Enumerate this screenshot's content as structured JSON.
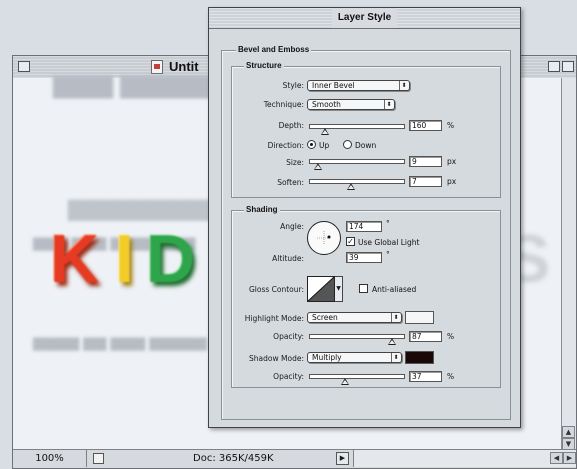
{
  "document": {
    "title": "Untit",
    "zoom": "100%",
    "doc_info": "Doc: 365K/459K",
    "kids_letters": [
      "K",
      "I",
      "D",
      "S"
    ]
  },
  "dialog": {
    "title": "Layer Style",
    "section_title": "Bevel and Emboss",
    "structure": {
      "group_label": "Structure",
      "style_label": "Style:",
      "style_value": "Inner Bevel",
      "technique_label": "Technique:",
      "technique_value": "Smooth",
      "depth_label": "Depth:",
      "depth_value": "160",
      "depth_unit": "%",
      "depth_level": 0.16,
      "direction_label": "Direction:",
      "direction_up": "Up",
      "direction_down": "Down",
      "direction_selected": "Up",
      "size_label": "Size:",
      "size_value": "9",
      "size_unit": "px",
      "size_level": 0.09,
      "soften_label": "Soften:",
      "soften_value": "7",
      "soften_unit": "px",
      "soften_level": 0.44
    },
    "shading": {
      "group_label": "Shading",
      "angle_label": "Angle:",
      "angle_value": "174",
      "angle_unit": "°",
      "use_global_light": "Use Global Light",
      "use_global_light_checked": true,
      "altitude_label": "Altitude:",
      "altitude_value": "39",
      "altitude_unit": "°",
      "gloss_contour_label": "Gloss Contour:",
      "anti_aliased": "Anti-aliased",
      "anti_aliased_checked": false,
      "highlight_mode_label": "Highlight Mode:",
      "highlight_mode_value": "Screen",
      "highlight_color": "#f4f6f8",
      "highlight_opacity_label": "Opacity:",
      "highlight_opacity_value": "87",
      "highlight_opacity_unit": "%",
      "highlight_opacity_level": 0.87,
      "shadow_mode_label": "Shadow Mode:",
      "shadow_mode_value": "Multiply",
      "shadow_color": "#1a0707",
      "shadow_opacity_label": "Opacity:",
      "shadow_opacity_value": "37",
      "shadow_opacity_unit": "%",
      "shadow_opacity_level": 0.37
    }
  }
}
